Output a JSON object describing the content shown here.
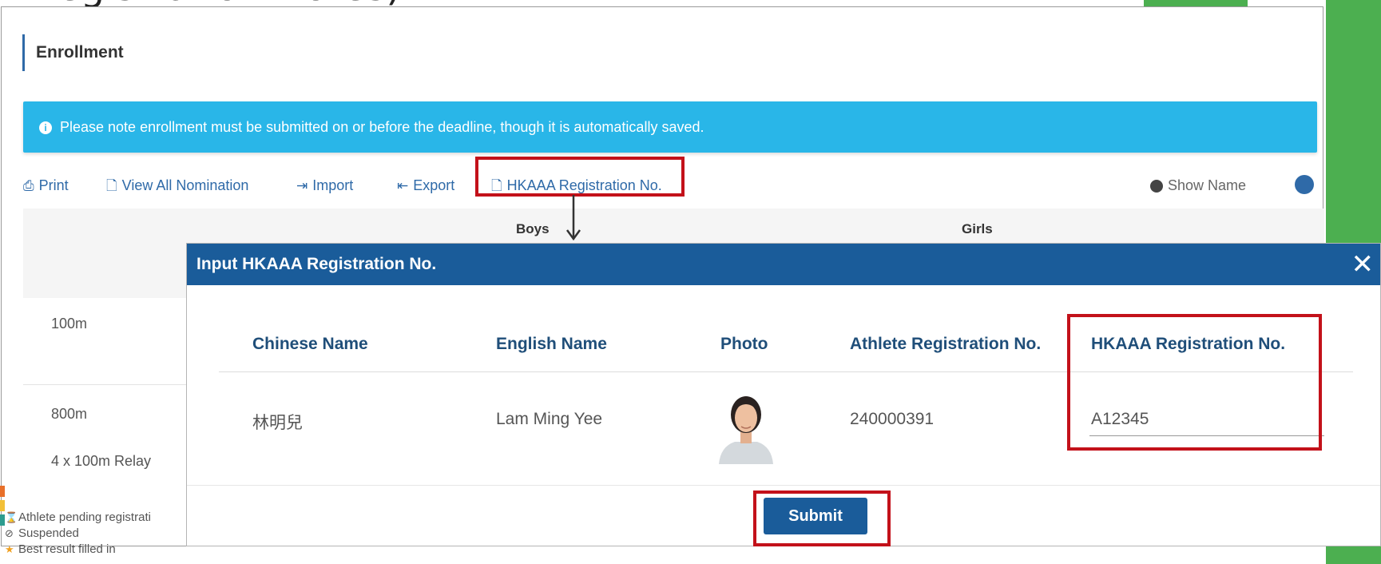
{
  "top_partial_text": "Registration Notes)",
  "page": {
    "title": "Enrollment",
    "notice": "Please note enrollment must be submitted on or before the deadline, though it is automatically saved."
  },
  "toolbar": {
    "print": "Print",
    "view_all_nomination": "View All Nomination",
    "import": "Import",
    "export": "Export",
    "hkaaa_registration": "HKAAA Registration No.",
    "show_name": "Show Name"
  },
  "table": {
    "col_boys": "Boys",
    "col_girls": "Girls",
    "events": [
      "100m",
      "800m",
      "4 x 100m Relay"
    ]
  },
  "legend": {
    "pending": "Athlete pending registrati",
    "suspended": "Suspended",
    "best_result": "Best result filled in"
  },
  "modal": {
    "title": "Input HKAAA Registration No.",
    "close": "✕",
    "headers": {
      "chinese_name": "Chinese Name",
      "english_name": "English Name",
      "photo": "Photo",
      "athlete_reg": "Athlete Registration No.",
      "hkaaa_reg": "HKAAA Registration No."
    },
    "row": {
      "chinese_name": "林明兒",
      "english_name": "Lam Ming Yee",
      "athlete_reg": "240000391",
      "hkaaa_reg": "A12345"
    },
    "submit": "Submit"
  },
  "colors": {
    "brand_blue": "#1a5c9a",
    "notice_blue": "#29b6e8",
    "highlight_red": "#c3111a",
    "side_green": "#4caf50"
  }
}
